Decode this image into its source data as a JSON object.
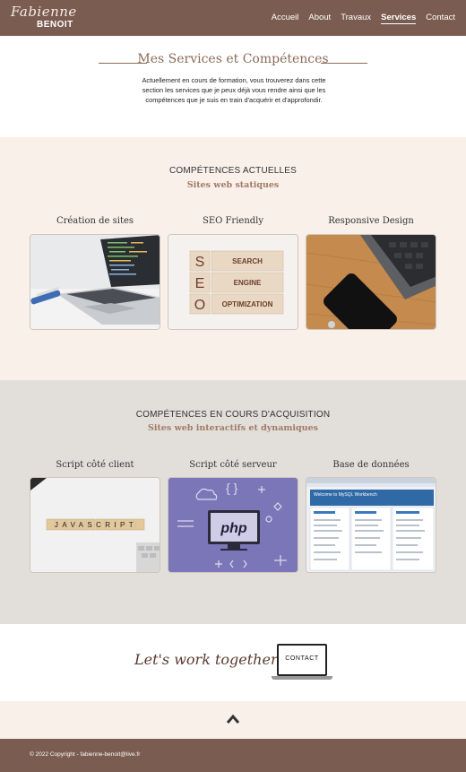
{
  "header": {
    "logo_script": "Fabienne",
    "logo_bold": "BENOIT",
    "nav": [
      "Accueil",
      "About",
      "Travaux",
      "Services",
      "Contact"
    ],
    "active": "Services"
  },
  "hero": {
    "title": "Mes Services et Compétences",
    "text": "Actuellement en cours de formation, vous trouverez dans cette section les services que je peux déjà vous rendre ainsi que les compétences que je suis en train d'acquérir et d'approfondir."
  },
  "current": {
    "title": "COMPÉTENCES ACTUELLES",
    "subtitle": "Sites web statiques",
    "cards": [
      "Création de sites",
      "SEO Friendly",
      "Responsive Design"
    ],
    "seo_letters": [
      "S",
      "E",
      "O"
    ],
    "seo_words": [
      "SEARCH",
      "ENGINE",
      "OPTIMIZATION"
    ]
  },
  "learning": {
    "title": "COMPÉTENCES EN COURS D'ACQUISITION",
    "subtitle": "Sites web interactifs et dynamiques",
    "cards": [
      "Script côté client",
      "Script côté serveur",
      "Base de données"
    ],
    "js_letters": "JAVASCRIPT",
    "php_label": "php",
    "db_banner": "Welcome to MySQL Workbench"
  },
  "cta": {
    "text": "Let's work together !",
    "button": "CONTACT"
  },
  "footer": {
    "copyright": "© 2022 Copyright - fabienne-benoit@live.fr"
  },
  "colors": {
    "brand": "#7b5c50",
    "accent": "#a07a65",
    "cream": "#f8f0e9",
    "grey": "#e2dfdb"
  }
}
